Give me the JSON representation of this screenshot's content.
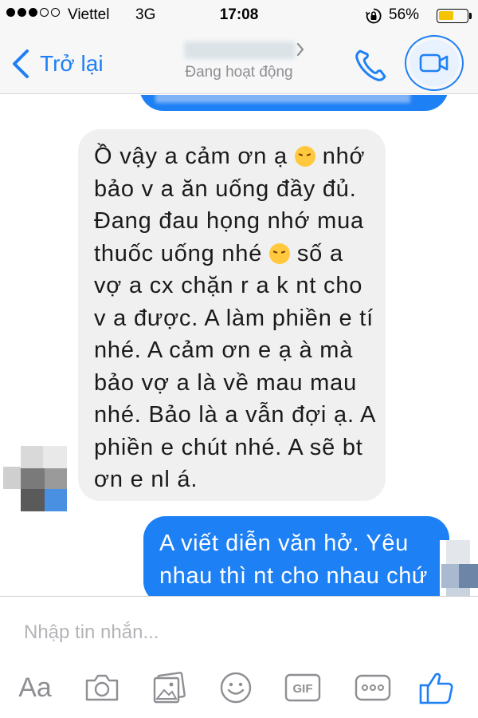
{
  "status_bar": {
    "carrier": "Viettel",
    "network": "3G",
    "time": "17:08",
    "battery_percent": "56%",
    "battery_level": 0.56,
    "signal_bars_filled": 3,
    "signal_bars_total": 5,
    "icons": [
      "signal-dots-icon",
      "orientation-lock-icon",
      "battery-icon"
    ]
  },
  "header": {
    "back_label": "Trở lại",
    "contact_status": "Đang hoạt động",
    "icons": [
      "back-chevron-icon",
      "chevron-right-icon",
      "phone-icon",
      "video-camera-icon"
    ]
  },
  "messages": [
    {
      "direction": "incoming",
      "lines": [
        "Ồ vậy a cảm ơn ạ",
        "nhớ",
        "bảo v a ăn uống đầy đủ.",
        "Đang đau họng nhớ mua",
        "thuốc uống nhé",
        "số a",
        "vợ a cx chặn r a k nt cho",
        "v a được. A làm phiền e tí",
        "nhé. A cảm ơn e ạ à mà",
        "bảo vợ a là về mau mau",
        "nhé. Bảo là a vẫn đợi ạ. A",
        "phiền e chút nhé. A sẽ bt",
        "ơn e nl á."
      ],
      "emoji": "disappointed-face-emoji"
    },
    {
      "direction": "outgoing",
      "lines": [
        "A viết diễn văn hở. Yêu",
        "nhau thì nt cho nhau chứ"
      ]
    }
  ],
  "composer": {
    "placeholder": "Nhập tin nhắn...",
    "value": "",
    "toolbar": {
      "aa_label": "Aa",
      "gif_label": "GIF",
      "icons": [
        "text-format-icon",
        "camera-icon",
        "photo-gallery-icon",
        "emoji-icon",
        "gif-icon",
        "more-icon",
        "thumbs-up-icon"
      ]
    }
  },
  "colors": {
    "accent": "#1e80f5",
    "incoming_bubble": "#f1f0f0",
    "outgoing_bubble": "#1e80f5",
    "battery": "#f5c400",
    "muted_text": "#8e8e93"
  }
}
